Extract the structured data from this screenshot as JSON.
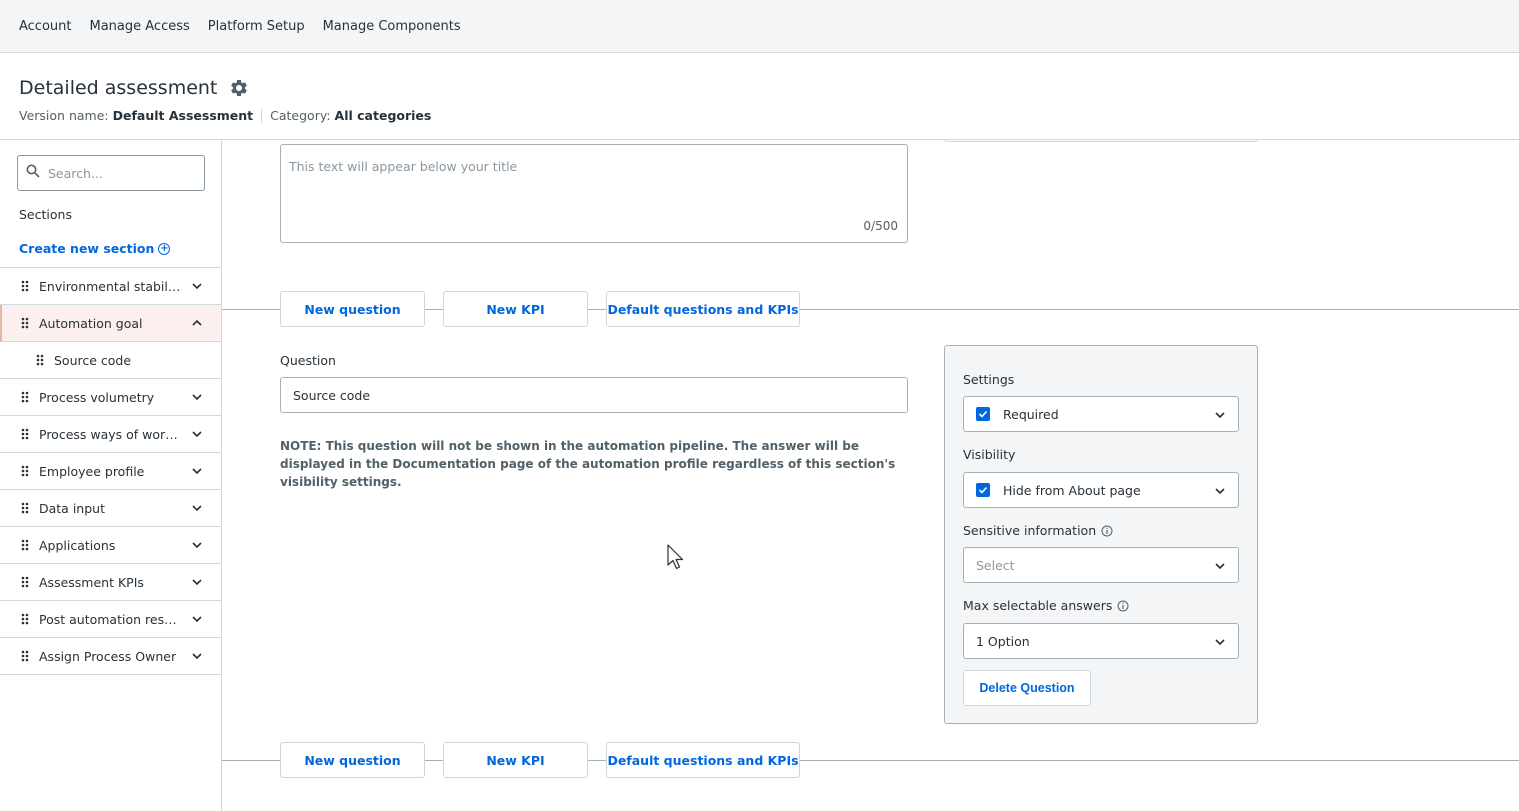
{
  "topnav": {
    "items": [
      "Account",
      "Manage Access",
      "Platform Setup",
      "Manage Components"
    ]
  },
  "header": {
    "title": "Detailed assessment",
    "version_label": "Version name:",
    "version_value": "Default Assessment",
    "category_label": "Category:",
    "category_value": "All categories"
  },
  "sidebar": {
    "search_placeholder": "Search...",
    "sections_label": "Sections",
    "create_label": "Create new section",
    "items": [
      {
        "label": "Environmental stability",
        "state": "collapsed"
      },
      {
        "label": "Automation goal",
        "state": "expanded"
      },
      {
        "label": "Source code",
        "state": "child"
      },
      {
        "label": "Process volumetry",
        "state": "collapsed"
      },
      {
        "label": "Process ways of worki...",
        "state": "collapsed"
      },
      {
        "label": "Employee profile",
        "state": "collapsed"
      },
      {
        "label": "Data input",
        "state": "collapsed"
      },
      {
        "label": "Applications",
        "state": "collapsed"
      },
      {
        "label": "Assessment KPIs",
        "state": "collapsed"
      },
      {
        "label": "Post automation results",
        "state": "collapsed"
      },
      {
        "label": "Assign Process Owner",
        "state": "collapsed"
      }
    ]
  },
  "main": {
    "description_placeholder": "This text will appear below your title",
    "description_count": "0/500",
    "actions": {
      "new_question": "New question",
      "new_kpi": "New KPI",
      "default_questions": "Default questions and KPIs"
    },
    "question_label": "Question",
    "question_value": "Source code",
    "note": "NOTE: This question will not be shown in the automation pipeline. The answer will be displayed in the Documentation page of the automation profile regardless of this section's visibility settings."
  },
  "settings": {
    "settings_label": "Settings",
    "required_label": "Required",
    "required_checked": true,
    "visibility_label": "Visibility",
    "hide_label": "Hide from About page",
    "hide_checked": true,
    "sensitive_label": "Sensitive information",
    "sensitive_placeholder": "Select",
    "max_label": "Max selectable answers",
    "max_value": "1 Option",
    "delete_label": "Delete Question"
  },
  "colors": {
    "accent": "#0067df",
    "active_bg": "#fbf0ed",
    "panel_bg": "#f4f5f7"
  }
}
